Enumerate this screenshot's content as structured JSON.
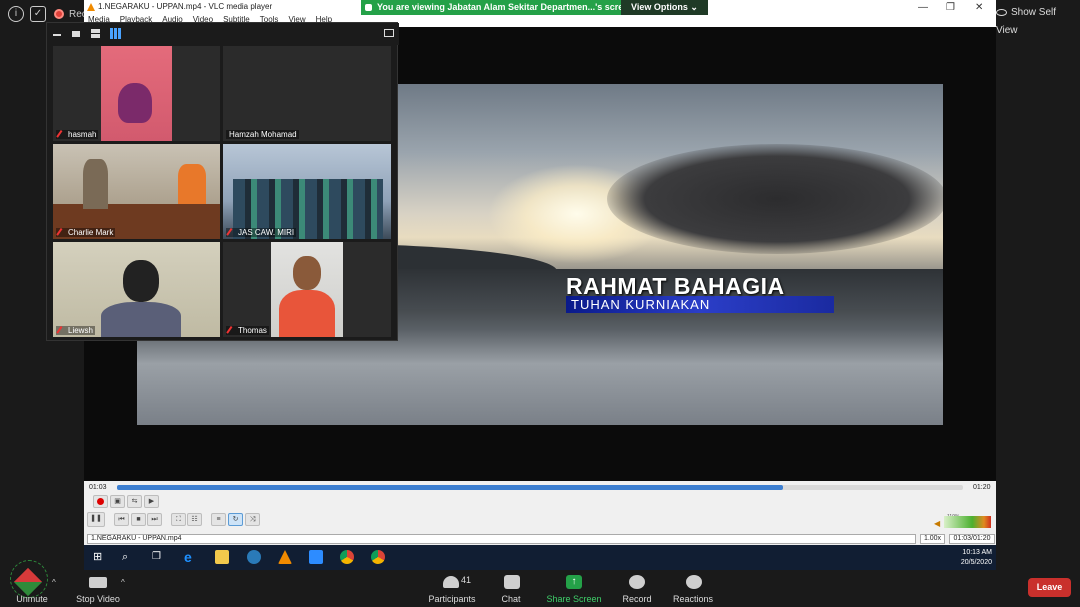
{
  "zoom": {
    "recording_label": "Rec",
    "share_banner": "You are viewing Jabatan Alam Sekitar Departmen...'s screen",
    "view_options": "View Options",
    "show_self_view": "Show Self View",
    "participants_count": "41",
    "bottom": {
      "unmute": "Unmute",
      "stop_video": "Stop Video",
      "participants": "Participants",
      "chat": "Chat",
      "share_screen": "Share Screen",
      "record": "Record",
      "reactions": "Reactions",
      "leave": "Leave"
    },
    "gallery": [
      {
        "name": "hasmah"
      },
      {
        "name": "Hamzah Mohamad"
      },
      {
        "name": "Charlie  Mark"
      },
      {
        "name": "JAS CAW. MIRI"
      },
      {
        "name": "Liewsh"
      },
      {
        "name": "Thomas"
      }
    ]
  },
  "vlc": {
    "title": "1.NEGARAKU - UPPAN.mp4 - VLC media player",
    "menu": [
      "Media",
      "Playback",
      "Audio",
      "Video",
      "Subtitle",
      "Tools",
      "View",
      "Help"
    ],
    "caption_main": "RAHMAT BAHAGIA",
    "caption_sub": "TUHAN KURNIAKAN",
    "time_current": "01:03",
    "time_total": "01:20",
    "progress": 0.7875,
    "volume_pct": "119%",
    "status_file": "1.NEGARAKU - UPPAN.mp4",
    "speed": "1.00x",
    "time_box": "01:03/01:20"
  },
  "taskbar": {
    "time": "10:13 AM",
    "date": "20/5/2020"
  },
  "colors": {
    "share_green": "#24a148",
    "leave_red": "#c9302c",
    "vlc_progress": "#3d7fd1"
  }
}
